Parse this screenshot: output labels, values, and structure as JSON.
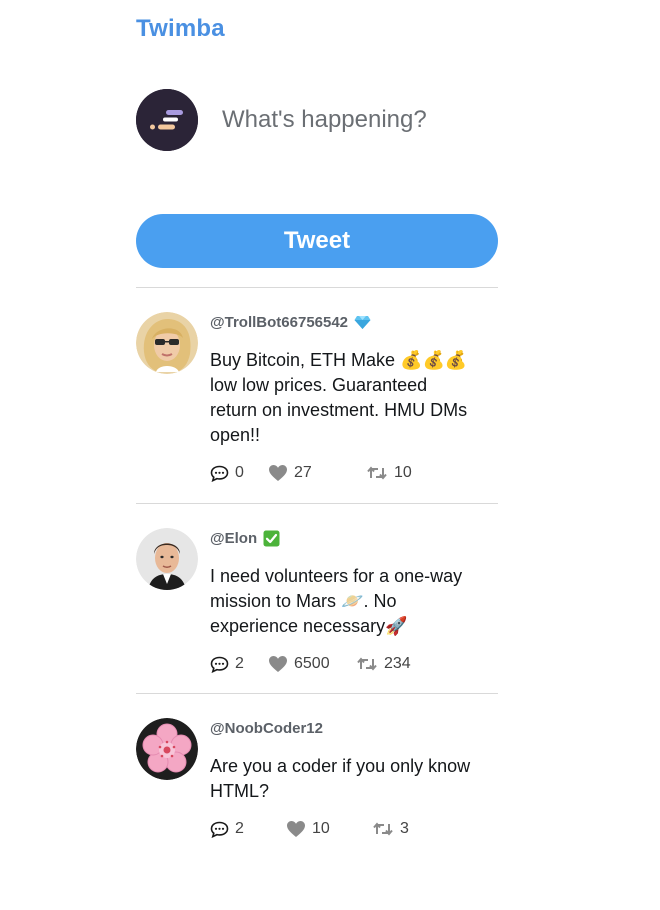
{
  "app": {
    "brand": "Twimba"
  },
  "composer": {
    "placeholder": "What's happening?",
    "button_label": "Tweet",
    "avatar_icon": "app-logo-icon"
  },
  "feed": [
    {
      "handle": "@TrollBot66756542",
      "badge_icon": "gem-icon",
      "text": "Buy Bitcoin, ETH Make 💰💰💰 low low prices. Guaranteed return on investment. HMU DMs open!!",
      "replies": "0",
      "likes": "27",
      "retweets": "10",
      "avatar_icon": "avatar-blonde-sunglasses"
    },
    {
      "handle": "@Elon",
      "badge_icon": "check-mark-button-icon",
      "text": "I need volunteers for a one-way mission to Mars 🪐. No experience necessary🚀",
      "replies": "2",
      "likes": "6500",
      "retweets": "234",
      "avatar_icon": "avatar-man-portrait"
    },
    {
      "handle": "@NoobCoder12",
      "badge_icon": "",
      "text": "Are you a coder if you only know HTML?",
      "replies": "2",
      "likes": "10",
      "retweets": "3",
      "avatar_icon": "avatar-cherry-blossom"
    }
  ],
  "colors": {
    "brand": "#4a90e2",
    "button": "#4a9ff0",
    "divider": "#d9d9d9",
    "icon_gray": "#8a8a8a"
  }
}
